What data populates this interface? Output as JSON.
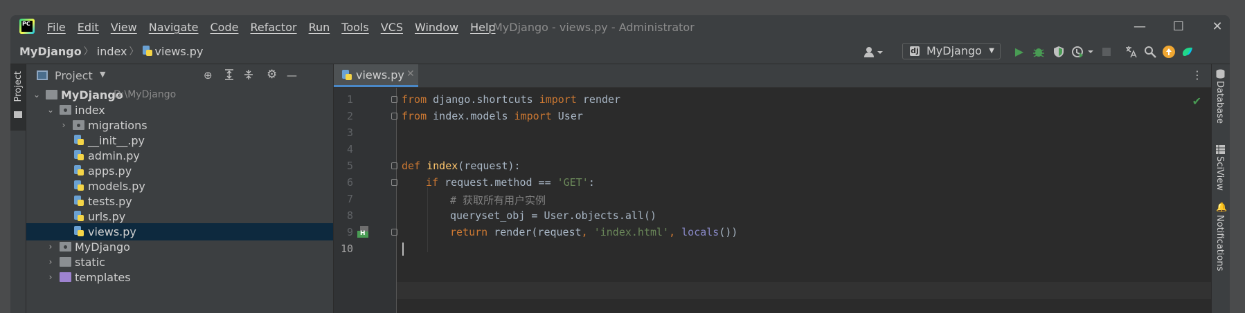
{
  "window": {
    "title": "MyDjango - views.py - Administrator",
    "logo_text": "PC",
    "menu": [
      "File",
      "Edit",
      "View",
      "Navigate",
      "Code",
      "Refactor",
      "Run",
      "Tools",
      "VCS",
      "Window",
      "Help"
    ],
    "controls": {
      "minimize": "—",
      "maximize": "☐",
      "close": "✕"
    }
  },
  "breadcrumb": {
    "project": "MyDjango",
    "folder": "index",
    "file": "views.py",
    "sep": "〉"
  },
  "toolbar": {
    "run_config": "MyDjango",
    "dj_badge": "dj",
    "icons": [
      "user-icon",
      "run-icon",
      "debug-icon",
      "coverage-icon",
      "profile-icon",
      "stop-icon",
      "translate-icon",
      "search-icon",
      "update-icon",
      "logo-icon"
    ],
    "colors": {
      "run": "#499c54",
      "update": "#f0a732"
    }
  },
  "left_stripe": {
    "project_label": "Project"
  },
  "project_panel": {
    "title": "Project",
    "tree": [
      {
        "label": "MyDjango",
        "path": "D:\\MyDjango"
      },
      {
        "label": "index"
      },
      {
        "label": "migrations"
      },
      {
        "label": "__init__.py"
      },
      {
        "label": "admin.py"
      },
      {
        "label": "apps.py"
      },
      {
        "label": "models.py"
      },
      {
        "label": "tests.py"
      },
      {
        "label": "urls.py"
      },
      {
        "label": "views.py"
      },
      {
        "label": "MyDjango"
      },
      {
        "label": "static"
      },
      {
        "label": "templates"
      }
    ]
  },
  "editor": {
    "tab": {
      "label": "views.py",
      "close": "✕"
    },
    "line_numbers": [
      "1",
      "2",
      "3",
      "4",
      "5",
      "6",
      "7",
      "8",
      "9",
      "10"
    ],
    "code": {
      "l1": {
        "k1": "from",
        "m": " django.shortcuts ",
        "k2": "import",
        "n": " render"
      },
      "l2": {
        "k1": "from",
        "m": " index.models ",
        "k2": "import",
        "n": " User"
      },
      "l5": {
        "k": "def",
        "sp": " ",
        "fn": "index",
        "rest": "(request):"
      },
      "l6": {
        "k": "if",
        "a": " request.method == ",
        "s": "'GET'",
        "b": ":"
      },
      "l7": {
        "c": "# 获取所有用户实例"
      },
      "l8": {
        "t": "queryset_obj = User.objects.all()"
      },
      "l9": {
        "k": "return",
        "a": " render(request",
        "c1": ", ",
        "s": "'index.html'",
        "c2": ", ",
        "bi": "locals",
        "b": "())"
      }
    },
    "gutter_badge": "H"
  },
  "right_stripe": {
    "database": "Database",
    "sciview": "SciView",
    "notifications": "Notifications"
  }
}
